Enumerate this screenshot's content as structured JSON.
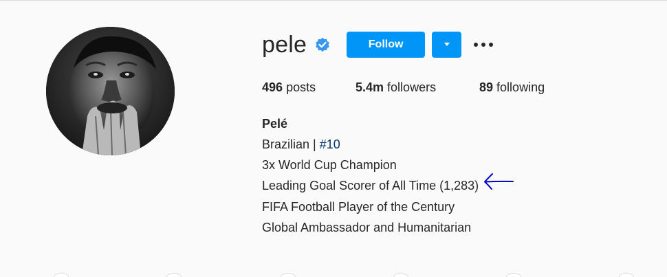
{
  "profile": {
    "username": "pele",
    "verified": true,
    "avatar_icon": "profile-photo"
  },
  "actions": {
    "follow_label": "Follow",
    "dropdown_icon": "caret-down-icon",
    "more_icon": "more-options-icon"
  },
  "stats": {
    "posts_count": "496",
    "posts_label": "posts",
    "followers_count": "5.4m",
    "followers_label": "followers",
    "following_count": "89",
    "following_label": "following"
  },
  "bio": {
    "name": "Pelé",
    "line1_text": "Brazilian | ",
    "line1_hashtag": "#10",
    "line2": "3x World Cup Champion",
    "line3": "Leading Goal Scorer of All Time (1,283)",
    "line4": "FIFA Football Player of the Century",
    "line5": "Global Ambassador and Humanitarian"
  },
  "colors": {
    "accent": "#0095f6",
    "verified_badge": "#3897f0",
    "hashtag": "#00376b",
    "annotation_arrow": "#0000cc"
  }
}
